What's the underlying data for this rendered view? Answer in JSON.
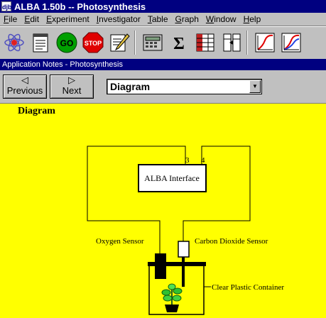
{
  "window": {
    "app_icon": "djb",
    "title": "ALBA 1.50b -- Photosynthesis"
  },
  "menu": [
    "File",
    "Edit",
    "Experiment",
    "Investigator",
    "Table",
    "Graph",
    "Window",
    "Help"
  ],
  "toolbar": {
    "go_label": "GO",
    "stop_label": "STOP"
  },
  "panel": {
    "title": "Application Notes - Photosynthesis"
  },
  "nav": {
    "previous_label": "Previous",
    "next_label": "Next",
    "page_select_value": "Diagram"
  },
  "content": {
    "heading": "Diagram",
    "interface_label": "ALBA Interface",
    "port_left": "3",
    "port_right": "4",
    "oxygen_sensor_label": "Oxygen Sensor",
    "co2_sensor_label": "Carbon Dioxide Sensor",
    "container_label": "Clear Plastic Container"
  },
  "colors": {
    "title_bar": "#000080",
    "background": "#ffff00",
    "go_button": "#00a000",
    "stop_button": "#e00000"
  }
}
